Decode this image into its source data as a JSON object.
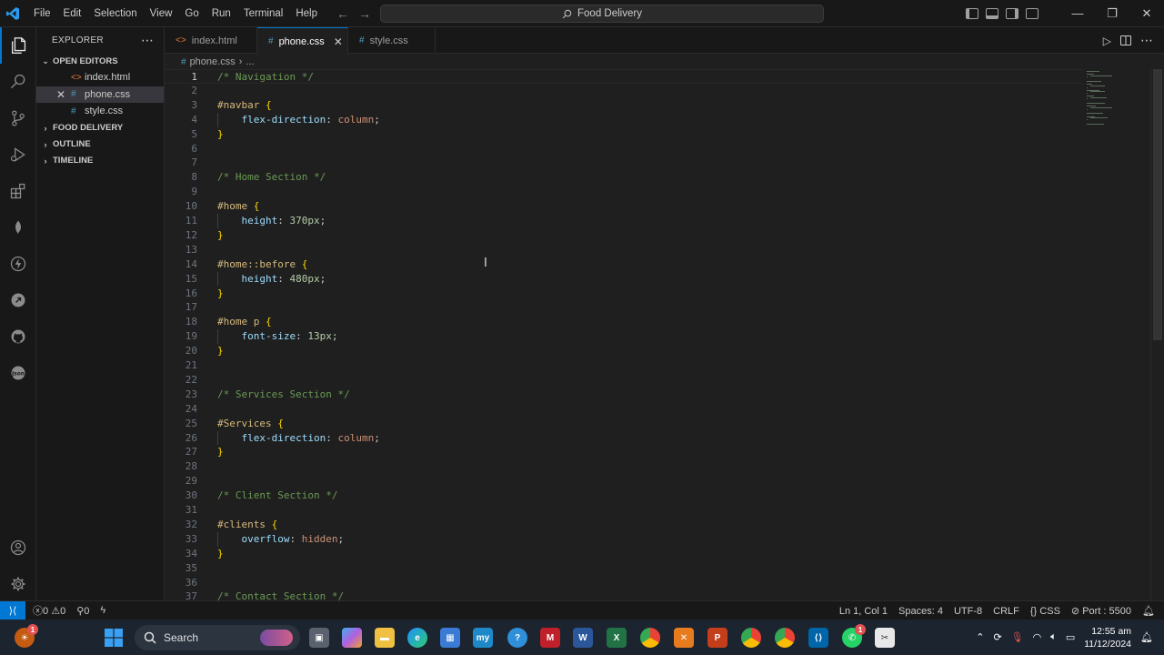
{
  "menu": [
    "File",
    "Edit",
    "Selection",
    "View",
    "Go",
    "Run",
    "Terminal",
    "Help"
  ],
  "command_center": "Food Delivery",
  "sidebar": {
    "title": "EXPLORER",
    "open_editors_label": "OPEN EDITORS",
    "open_editors": [
      {
        "name": "index.html",
        "icon": "html-file-icon"
      },
      {
        "name": "phone.css",
        "icon": "css-file-icon"
      },
      {
        "name": "style.css",
        "icon": "css-file-icon"
      }
    ],
    "folder_label": "FOOD DELIVERY",
    "outline_label": "OUTLINE",
    "timeline_label": "TIMELINE"
  },
  "tabs": [
    {
      "label": "index.html",
      "icon": "html-file-icon"
    },
    {
      "label": "phone.css",
      "icon": "css-file-icon",
      "active": true
    },
    {
      "label": "style.css",
      "icon": "css-file-icon"
    }
  ],
  "breadcrumb": {
    "file": "phone.css",
    "rest": "..."
  },
  "editor": {
    "current_line": 1,
    "lines": [
      [
        [
          "comment",
          "/* Navigation */"
        ]
      ],
      [],
      [
        [
          "selector",
          "#navbar "
        ],
        [
          "brace",
          "{"
        ]
      ],
      [
        [
          "indent",
          "    "
        ],
        [
          "prop",
          "flex-direction"
        ],
        [
          "punc",
          ": "
        ],
        [
          "val",
          "column"
        ],
        [
          "punc",
          ";"
        ]
      ],
      [
        [
          "brace",
          "}"
        ]
      ],
      [],
      [],
      [
        [
          "comment",
          "/* Home Section */"
        ]
      ],
      [],
      [
        [
          "selector",
          "#home "
        ],
        [
          "brace",
          "{"
        ]
      ],
      [
        [
          "indent",
          "    "
        ],
        [
          "prop",
          "height"
        ],
        [
          "punc",
          ": "
        ],
        [
          "num",
          "370px"
        ],
        [
          "punc",
          ";"
        ]
      ],
      [
        [
          "brace",
          "}"
        ]
      ],
      [],
      [
        [
          "selector",
          "#home::before "
        ],
        [
          "brace",
          "{"
        ]
      ],
      [
        [
          "indent",
          "    "
        ],
        [
          "prop",
          "height"
        ],
        [
          "punc",
          ": "
        ],
        [
          "num",
          "480px"
        ],
        [
          "punc",
          ";"
        ]
      ],
      [
        [
          "brace",
          "}"
        ]
      ],
      [],
      [
        [
          "selector",
          "#home p "
        ],
        [
          "brace",
          "{"
        ]
      ],
      [
        [
          "indent",
          "    "
        ],
        [
          "prop",
          "font-size"
        ],
        [
          "punc",
          ": "
        ],
        [
          "num",
          "13px"
        ],
        [
          "punc",
          ";"
        ]
      ],
      [
        [
          "brace",
          "}"
        ]
      ],
      [],
      [],
      [
        [
          "comment",
          "/* Services Section */"
        ]
      ],
      [],
      [
        [
          "selector",
          "#Services "
        ],
        [
          "brace",
          "{"
        ]
      ],
      [
        [
          "indent",
          "    "
        ],
        [
          "prop",
          "flex-direction"
        ],
        [
          "punc",
          ": "
        ],
        [
          "val",
          "column"
        ],
        [
          "punc",
          ";"
        ]
      ],
      [
        [
          "brace",
          "}"
        ]
      ],
      [],
      [],
      [
        [
          "comment",
          "/* Client Section */"
        ]
      ],
      [],
      [
        [
          "selector",
          "#clients "
        ],
        [
          "brace",
          "{"
        ]
      ],
      [
        [
          "indent",
          "    "
        ],
        [
          "prop",
          "overflow"
        ],
        [
          "punc",
          ": "
        ],
        [
          "val",
          "hidden"
        ],
        [
          "punc",
          ";"
        ]
      ],
      [
        [
          "brace",
          "}"
        ]
      ],
      [],
      [],
      [
        [
          "comment",
          "/* Contact Section */"
        ]
      ]
    ]
  },
  "status": {
    "errors": "0",
    "warnings": "0",
    "ports_count": "0",
    "cursor": "Ln 1, Col 1",
    "spaces": "Spaces: 4",
    "encoding": "UTF-8",
    "eol": "CRLF",
    "language": "CSS",
    "port": "Port : 5500"
  },
  "taskbar": {
    "search_placeholder": "Search",
    "time": "12:55 am",
    "date": "11/12/2024",
    "whatsapp_badge": "1",
    "weather_badge": "1"
  },
  "colors": {
    "accent": "#0078d4",
    "editor_bg": "#1f1f1f",
    "chrome_bg": "#181818",
    "comment": "#6a9955",
    "selector": "#d7ba7d",
    "property": "#9cdcfe",
    "number": "#b5cea8",
    "string_value": "#ce9178",
    "brace": "#ffd700"
  }
}
